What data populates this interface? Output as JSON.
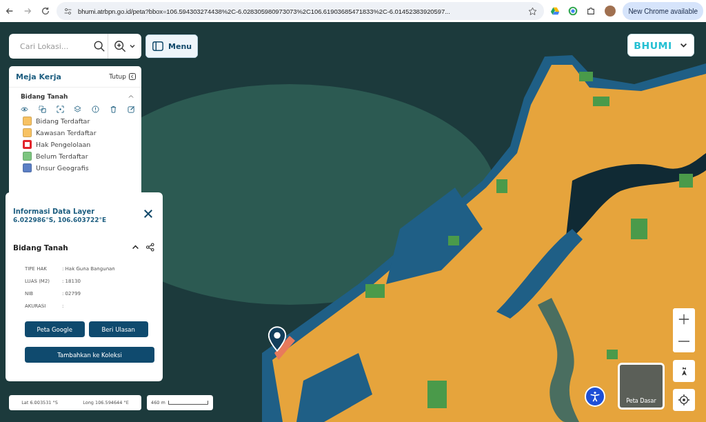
{
  "browser": {
    "url": "bhumi.atrbpn.go.id/peta?bbox=106.594303274438%2C-6.028305980973073%2C106.61903685471833%2C-6.01452383920597...",
    "update_button": "New Chrome available"
  },
  "search": {
    "placeholder": "Cari Lokasi..."
  },
  "menu_button": "Menu",
  "logo": "BHUMI",
  "workspace": {
    "title": "Meja Kerja",
    "close": "Tutup",
    "layer": {
      "name": "Bidang Tanah",
      "expanded": true
    },
    "legend": [
      {
        "label": "Bidang Terdaftar",
        "kind": "fill",
        "color": "#f7c263"
      },
      {
        "label": "Kawasan Terdaftar",
        "kind": "fill",
        "color": "#f7c263"
      },
      {
        "label": "Hak Pengelolaan",
        "kind": "outline",
        "color": "#e2242b"
      },
      {
        "label": "Belum Terdaftar",
        "kind": "fill",
        "color": "#7cc57f"
      },
      {
        "label": "Unsur Geografis",
        "kind": "fill",
        "color": "#5b7fc4"
      }
    ]
  },
  "info": {
    "title": "Informasi Data Layer",
    "coords": "6.022986°S, 106.603722°E",
    "section": {
      "title": "Bidang Tanah",
      "expanded": true
    },
    "fields": [
      {
        "label": "TIPE HAK",
        "value": ": Hak Guna Bangunan"
      },
      {
        "label": "LUAS (M2)",
        "value": ": 18130"
      },
      {
        "label": "NIB",
        "value": ": 02799"
      },
      {
        "label": "AKURASI",
        "value": ":"
      }
    ],
    "buttons": [
      "Peta Google",
      "Beri Ulasan"
    ],
    "wide_button": "Tambahkan ke Koleksi"
  },
  "status": {
    "lat": "Lat 6.003531 °S",
    "long": "Long 106.594644 °E",
    "scale": "460 m"
  },
  "basemap": {
    "label": "Peta Dasar"
  }
}
